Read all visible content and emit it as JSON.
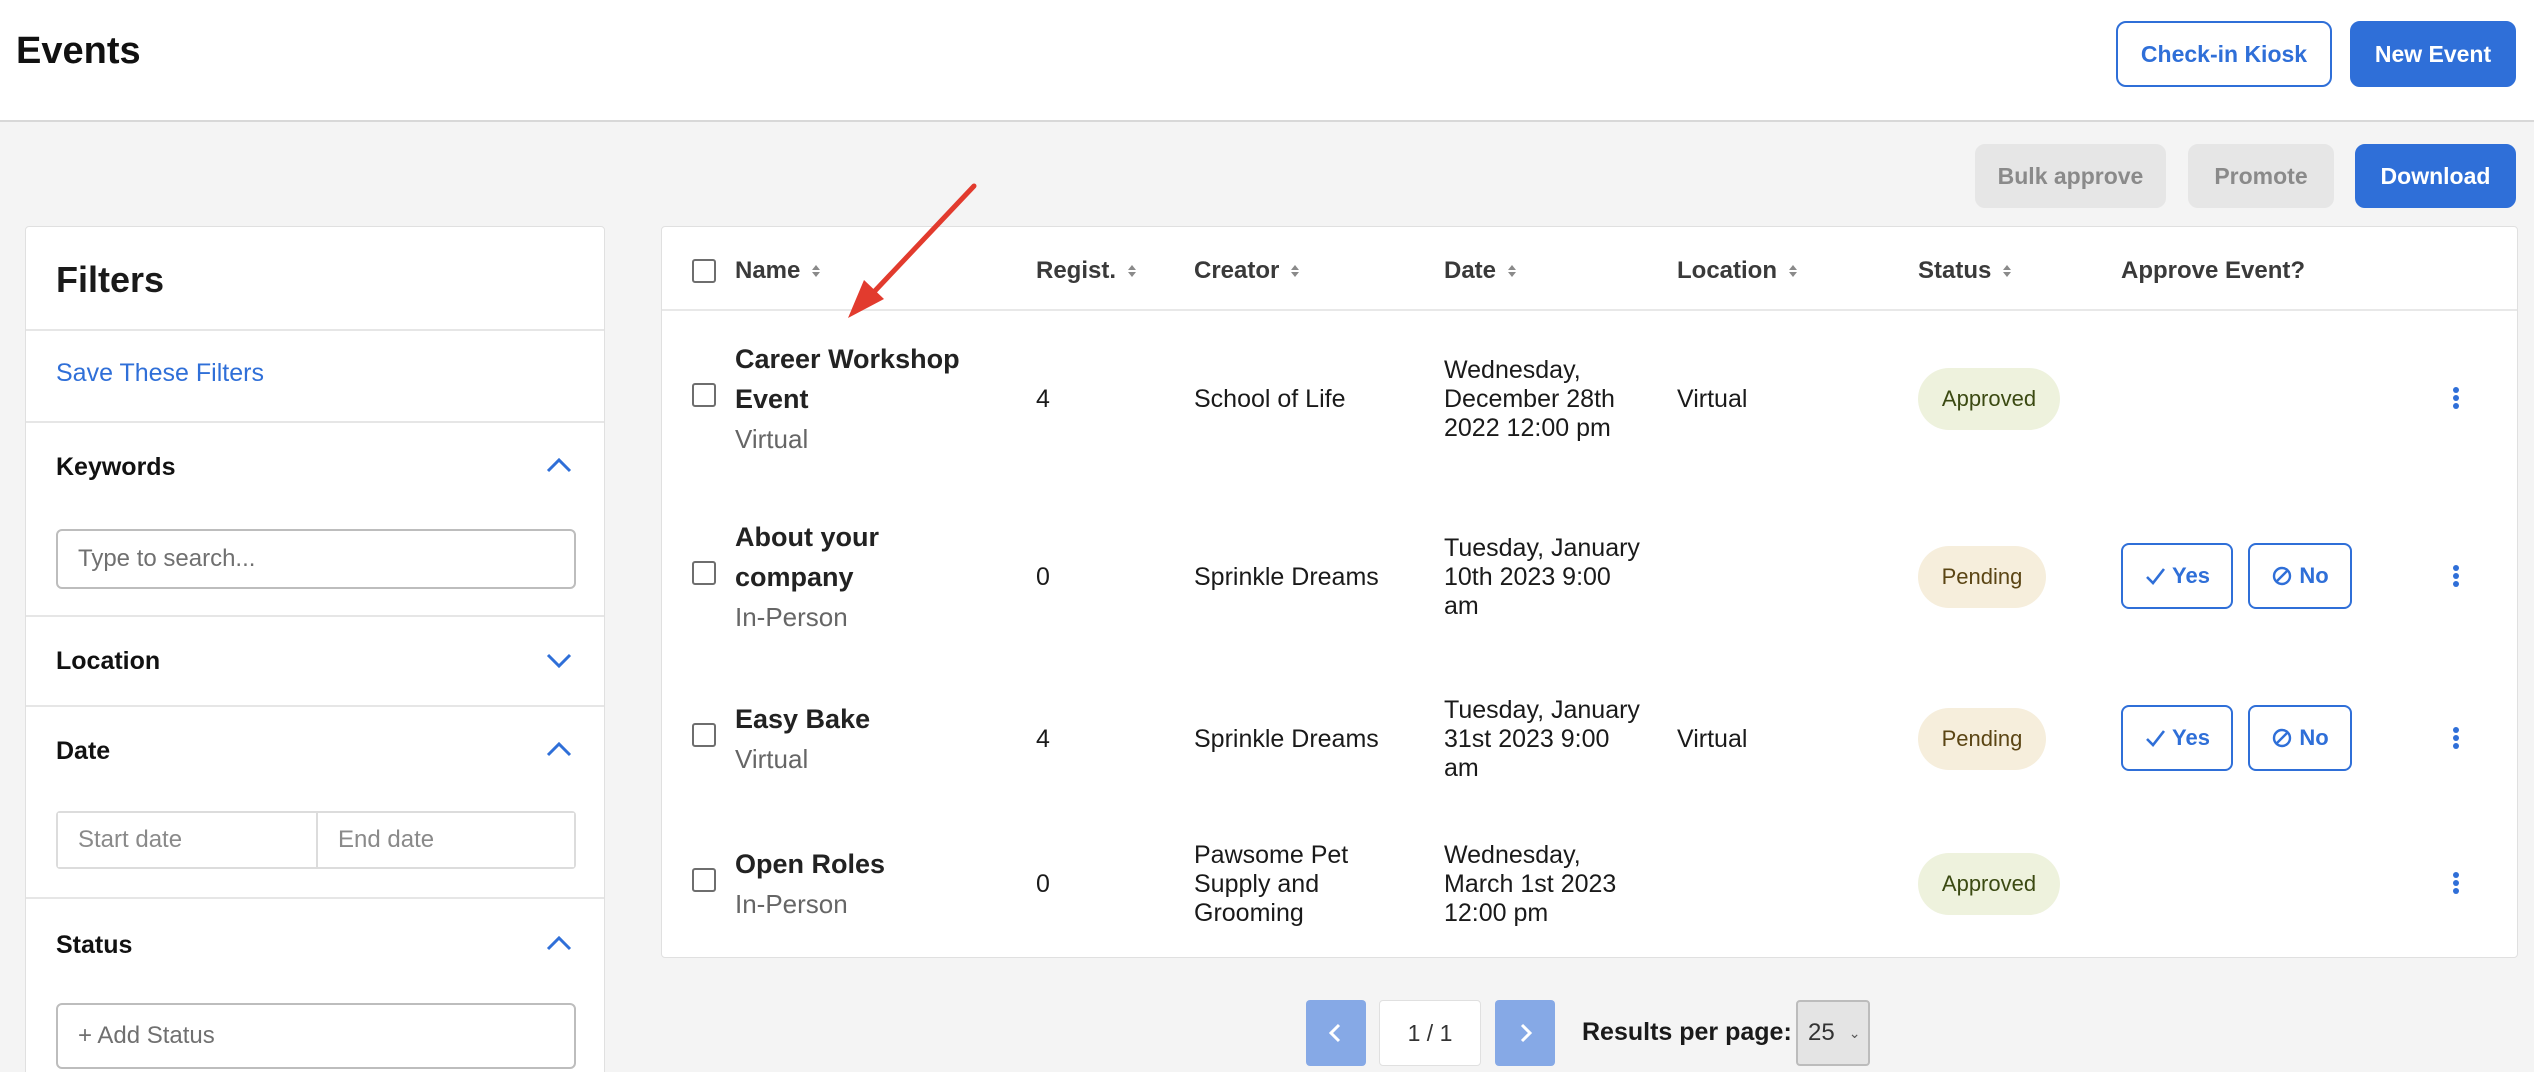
{
  "header": {
    "title": "Events",
    "checkin_label": "Check-in Kiosk",
    "new_event_label": "New Event"
  },
  "toolbar": {
    "bulk_approve_label": "Bulk approve",
    "promote_label": "Promote",
    "download_label": "Download"
  },
  "filters": {
    "title": "Filters",
    "save_label": "Save These Filters",
    "keywords": {
      "label": "Keywords",
      "placeholder": "Type to search..."
    },
    "location": {
      "label": "Location"
    },
    "date": {
      "label": "Date",
      "start_placeholder": "Start date",
      "end_placeholder": "End date"
    },
    "status": {
      "label": "Status",
      "placeholder": "+ Add Status"
    }
  },
  "table": {
    "columns": {
      "name": "Name",
      "registrations": "Regist.",
      "creator": "Creator",
      "date": "Date",
      "location": "Location",
      "status": "Status",
      "approve": "Approve Event?"
    },
    "rows": [
      {
        "name_line1": "Career Workshop",
        "name_line2": "Event",
        "type": "Virtual",
        "registrations": "4",
        "creator_line1": "School of Life",
        "date_line1": "Wednesday,",
        "date_line2": "December 28th",
        "date_line3": "2022 12:00 pm",
        "location": "Virtual",
        "status": "Approved"
      },
      {
        "name_line1": "About your",
        "name_line2": "company",
        "type": "In-Person",
        "registrations": "0",
        "creator_line1": "Sprinkle Dreams",
        "date_line1": "Tuesday, January",
        "date_line2": "10th 2023 9:00",
        "date_line3": "am",
        "location": "",
        "status": "Pending",
        "yes_label": "Yes",
        "no_label": "No"
      },
      {
        "name_line1": "Easy Bake",
        "type": "Virtual",
        "registrations": "4",
        "creator_line1": "Sprinkle Dreams",
        "date_line1": "Tuesday, January",
        "date_line2": "31st 2023 9:00",
        "date_line3": "am",
        "location": "Virtual",
        "status": "Pending",
        "yes_label": "Yes",
        "no_label": "No"
      },
      {
        "name_line1": "Open Roles",
        "type": "In-Person",
        "registrations": "0",
        "creator_line1": "Pawsome Pet",
        "creator_line2": "Supply and",
        "creator_line3": "Grooming",
        "date_line1": "Wednesday,",
        "date_line2": "March 1st 2023",
        "date_line3": "12:00 pm",
        "location": "",
        "status": "Approved"
      }
    ]
  },
  "pagination": {
    "page_indicator": "1 / 1",
    "results_per_page_label": "Results per page:",
    "results_per_page_value": "25"
  },
  "colors": {
    "primary": "#2f6fd8",
    "annotation_arrow": "#e23b2e"
  },
  "icons": {
    "sort": "sort-icon",
    "chevron_up": "chevron-up-icon",
    "chevron_down": "chevron-down-icon",
    "check": "check-icon",
    "ban": "ban-icon",
    "kebab": "kebab-menu-icon",
    "chevron_left": "chevron-left-icon",
    "chevron_right": "chevron-right-icon"
  }
}
